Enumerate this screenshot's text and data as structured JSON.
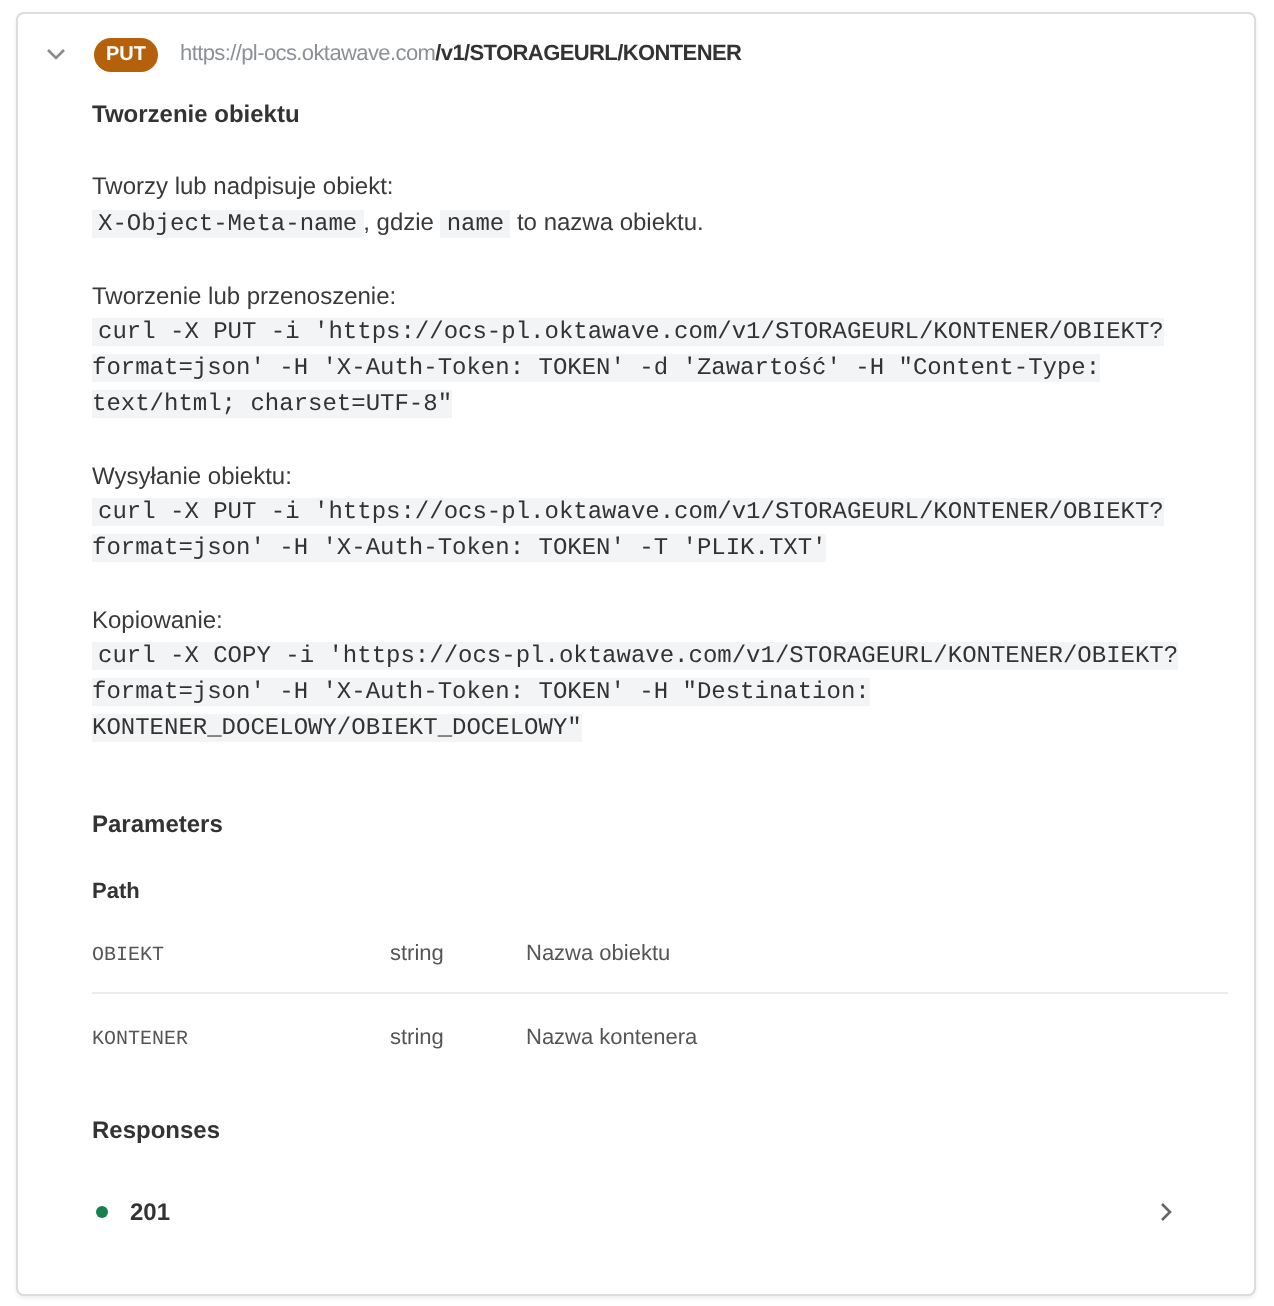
{
  "endpoint": {
    "expanded": true,
    "method": "PUT",
    "base_url": "https://pl-ocs.oktawave.com",
    "path": "/v1/STORAGEURL/KONTENER"
  },
  "summary": "Tworzenie obiektu",
  "description": [
    {
      "kind": "text",
      "intro": "Tworzy lub nadpisuje obiekt:",
      "segments": [
        {
          "kind": "code",
          "text": "X-Object-Meta-name"
        },
        {
          "kind": "text",
          "text": ", gdzie "
        },
        {
          "kind": "code",
          "text": "name"
        },
        {
          "kind": "text",
          "text": " to nazwa obiektu."
        }
      ]
    },
    {
      "kind": "command",
      "intro": "Tworzenie lub przenoszenie:",
      "code": "curl -X PUT -i 'https://ocs-pl.oktawave.com/v1/STORAGEURL/KONTENER/OBIEKT?format=json' -H 'X-Auth-Token: TOKEN' -d 'Zawartość' -H \"Content-Type: text/html; charset=UTF-8\""
    },
    {
      "kind": "command",
      "intro": "Wysyłanie obiektu:",
      "code": "curl -X PUT -i 'https://ocs-pl.oktawave.com/v1/STORAGEURL/KONTENER/OBIEKT?format=json' -H 'X-Auth-Token: TOKEN' -T 'PLIK.TXT'"
    },
    {
      "kind": "command",
      "intro": "Kopiowanie:",
      "code": "curl -X COPY -i 'https://ocs-pl.oktawave.com/v1/STORAGEURL/KONTENER/OBIEKT?format=json' -H 'X-Auth-Token: TOKEN' -H \"Destination: KONTENER_DOCELOWY/OBIEKT_DOCELOWY\""
    }
  ],
  "parameters": {
    "title": "Parameters",
    "groups": [
      {
        "title": "Path",
        "rows": [
          {
            "name": "OBIEKT",
            "type": "string",
            "description": "Nazwa obiektu"
          },
          {
            "name": "KONTENER",
            "type": "string",
            "description": "Nazwa kontenera"
          }
        ]
      }
    ]
  },
  "responses": {
    "title": "Responses",
    "items": [
      {
        "code": "201",
        "color": "#17824d",
        "expanded": false
      }
    ]
  }
}
